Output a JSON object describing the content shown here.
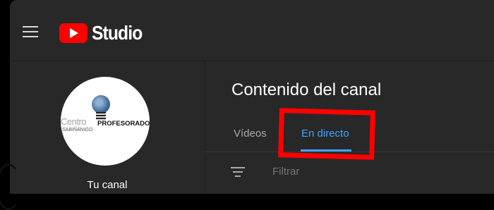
{
  "header": {
    "logo_text": "Studio"
  },
  "sidebar": {
    "channel_label": "Tu canal",
    "avatar": {
      "line1": "Centro",
      "line2": "PROFESORADO",
      "line3": "SABIÑÁNIGO"
    }
  },
  "main": {
    "title": "Contenido del canal",
    "tabs": [
      {
        "label": "Vídeos",
        "active": false
      },
      {
        "label": "En directo",
        "active": true
      }
    ],
    "filter": {
      "placeholder": "Filtrar"
    }
  },
  "colors": {
    "background": "#282828",
    "accent": "#3ea6ff",
    "brand": "#ff0000",
    "annotation": "#ff0000"
  },
  "icons": [
    "menu-icon",
    "youtube-logo-icon",
    "filter-icon"
  ]
}
